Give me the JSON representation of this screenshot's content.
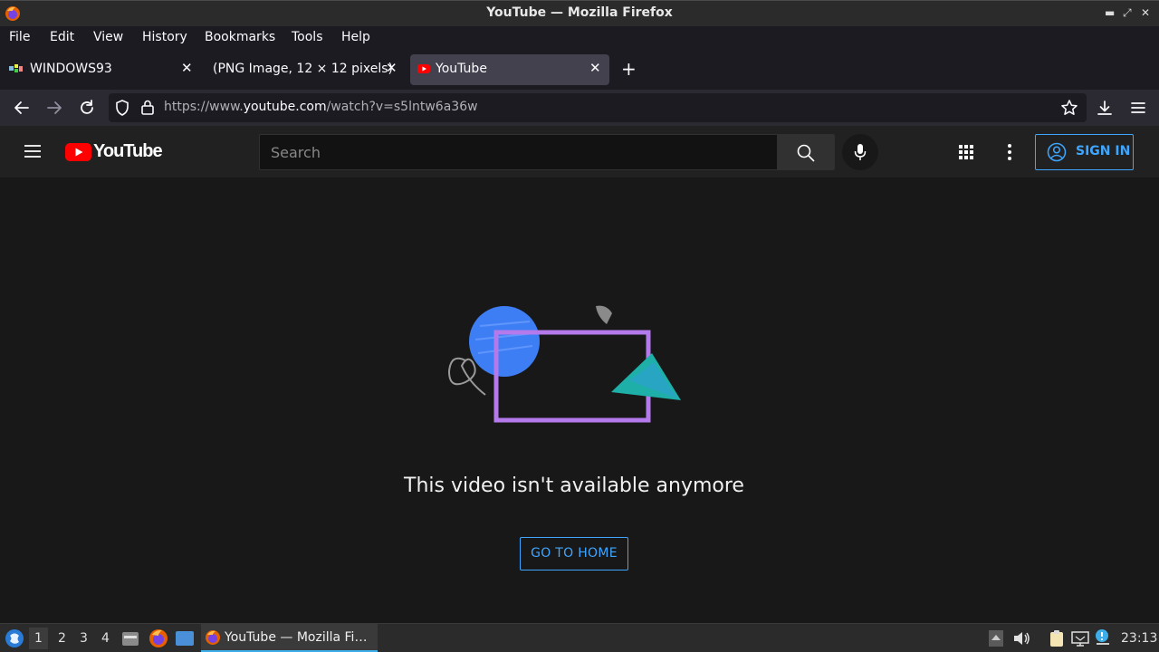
{
  "window": {
    "title": "YouTube — Mozilla Firefox"
  },
  "menu": [
    "File",
    "Edit",
    "View",
    "History",
    "Bookmarks",
    "Tools",
    "Help"
  ],
  "tabs": [
    {
      "label": "WINDOWS93"
    },
    {
      "label": "(PNG Image, 12 × 12 pixels)"
    },
    {
      "label": "YouTube"
    }
  ],
  "url": {
    "prefix": "https://www.",
    "host": "youtube.com",
    "path": "/watch?v=s5lntw6a36w"
  },
  "youtube": {
    "logo_text": "YouTube",
    "search_placeholder": "Search",
    "sign_in": "SIGN IN",
    "message": "This video isn't available anymore",
    "home_button": "GO TO HOME"
  },
  "taskbar": {
    "workspaces": [
      "1",
      "2",
      "3",
      "4"
    ],
    "task_label": "YouTube — Mozilla Fi…",
    "clock": "23:13"
  },
  "colors": {
    "accent_blue": "#3ea6ff",
    "yt_red": "#ff0000",
    "purple": "#b47aeb"
  }
}
